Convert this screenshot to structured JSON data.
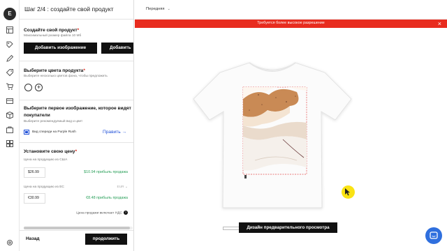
{
  "rail": {
    "avatar_initial": "E",
    "icons": [
      "layout-icon",
      "tag-edit-icon",
      "pencil-icon",
      "price-tag-icon",
      "cart-icon",
      "card-icon",
      "box-icon",
      "bag-icon",
      "grid-icon",
      "settings-icon"
    ]
  },
  "panel": {
    "step_title": "Шаг 2/4 : создайте свой продукт",
    "create": {
      "title": "Создайте свой продукт",
      "required_mark": "*",
      "subtitle": "Максимальный размер файла 10 Мб",
      "add_image_label": "Добавить изображение",
      "add_second_label": "Добавить"
    },
    "colors": {
      "title": "Выберите цвета продукта",
      "required_mark": "*",
      "subtitle": "Выберите несколько цветов фона, чтобы предложить",
      "swatch_color": "#ffffff",
      "add_symbol": "+"
    },
    "first_image": {
      "title_line1": "Выберите первое изображение, которое видят",
      "title_line2": "покупатели",
      "subtitle": "Выберите рекомендуемый вид и цвет",
      "option_text": "Вид спереди на Purple Rush",
      "edit_link": "Править →"
    },
    "price": {
      "title": "Установите свою цену",
      "required_mark": "*",
      "us_label": "Цена на продукцию из США",
      "us_value": "$26.99",
      "us_profit": "$10.94 прибыль продажа",
      "eu_label": "Цена на продукцию из ЕС",
      "eu_currency": "EUR ⌄",
      "eu_value": "€30.99",
      "eu_profit": "€8.48 прибыль продажа",
      "vat_note": "Цена продажи включает НДС",
      "vat_icon": "?"
    },
    "footer": {
      "back_label": "Назад",
      "next_label": "продолжить"
    }
  },
  "canvas": {
    "view_select": "Передняя",
    "banner_text": "Требуется более высокое разрешение",
    "banner_close": "×",
    "preview_button": "Дизайн предварительного просмотра"
  },
  "colors": {
    "accent_red": "#e82c1f",
    "profit_green": "#2aa05a",
    "link_blue": "#1d4ed8",
    "chat_blue": "#2f6fde",
    "design_brown": "#c98a55"
  }
}
